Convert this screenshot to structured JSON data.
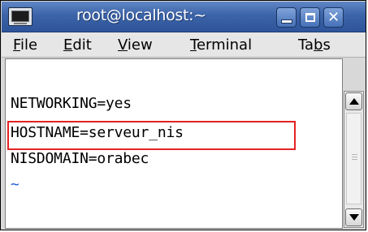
{
  "window": {
    "title": "root@localhost:~"
  },
  "menubar": {
    "items": [
      {
        "label_u": "F",
        "label_rest": "ile"
      },
      {
        "label_u": "E",
        "label_rest": "dit"
      },
      {
        "label_u": "V",
        "label_rest": "iew"
      },
      {
        "label_u": "T",
        "label_rest": "erminal"
      },
      {
        "label_pre": "Ta",
        "label_u": "b",
        "label_rest": "s"
      }
    ]
  },
  "terminal": {
    "lines": [
      "NETWORKING=yes",
      "HOSTNAME=serveur_nis",
      "NISDOMAIN=orabec",
      "~"
    ],
    "highlighted_line_index": 1
  },
  "colors": {
    "highlight": "#e52222",
    "tilde": "#1f5bd7",
    "titlebar": "#3c64a8"
  },
  "icons": {
    "window_icon": "terminal-icon",
    "minimize": "minimize-icon",
    "maximize": "maximize-icon",
    "close": "close-icon",
    "scroll_up": "arrow-up-icon",
    "scroll_down": "arrow-down-icon"
  }
}
